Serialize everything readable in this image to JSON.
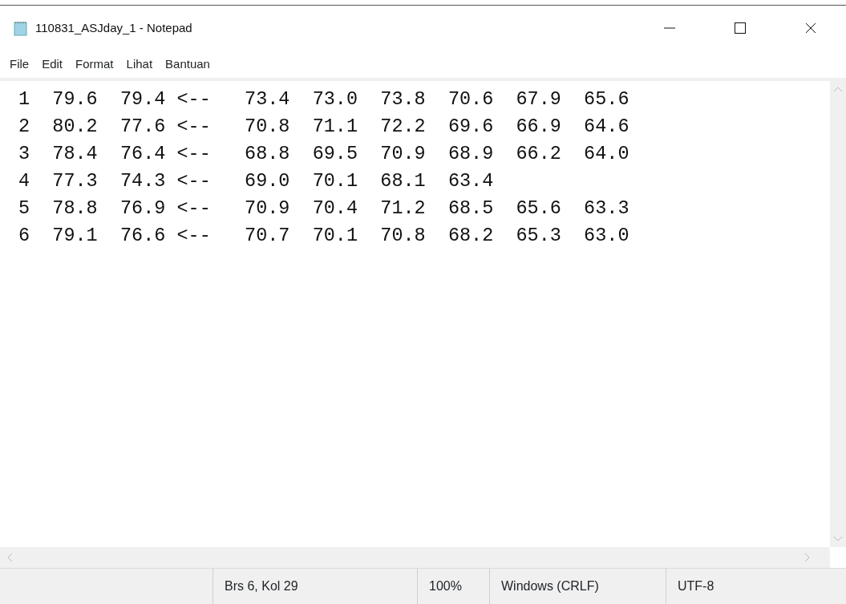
{
  "window": {
    "title": "110831_ASJday_1 - Notepad"
  },
  "menu": [
    "File",
    "Edit",
    "Format",
    "Lihat",
    "Bantuan"
  ],
  "lines": [
    "1  79.6  79.4 <--   73.4  73.0  73.8  70.6  67.9  65.6",
    "2  80.2  77.6 <--   70.8  71.1  72.2  69.6  66.9  64.6",
    "3  78.4  76.4 <--   68.8  69.5  70.9  68.9  66.2  64.0",
    "4  77.3  74.3 <--   69.0  70.1  68.1  63.4",
    "5  78.8  76.9 <--   70.9  70.4  71.2  68.5  65.6  63.3",
    "6  79.1  76.6 <--   70.7  70.1  70.8  68.2  65.3  63.0"
  ],
  "status_bar": [
    "Brs 6, Kol 29",
    "100%",
    "Windows (CRLF)",
    "UTF-8"
  ]
}
